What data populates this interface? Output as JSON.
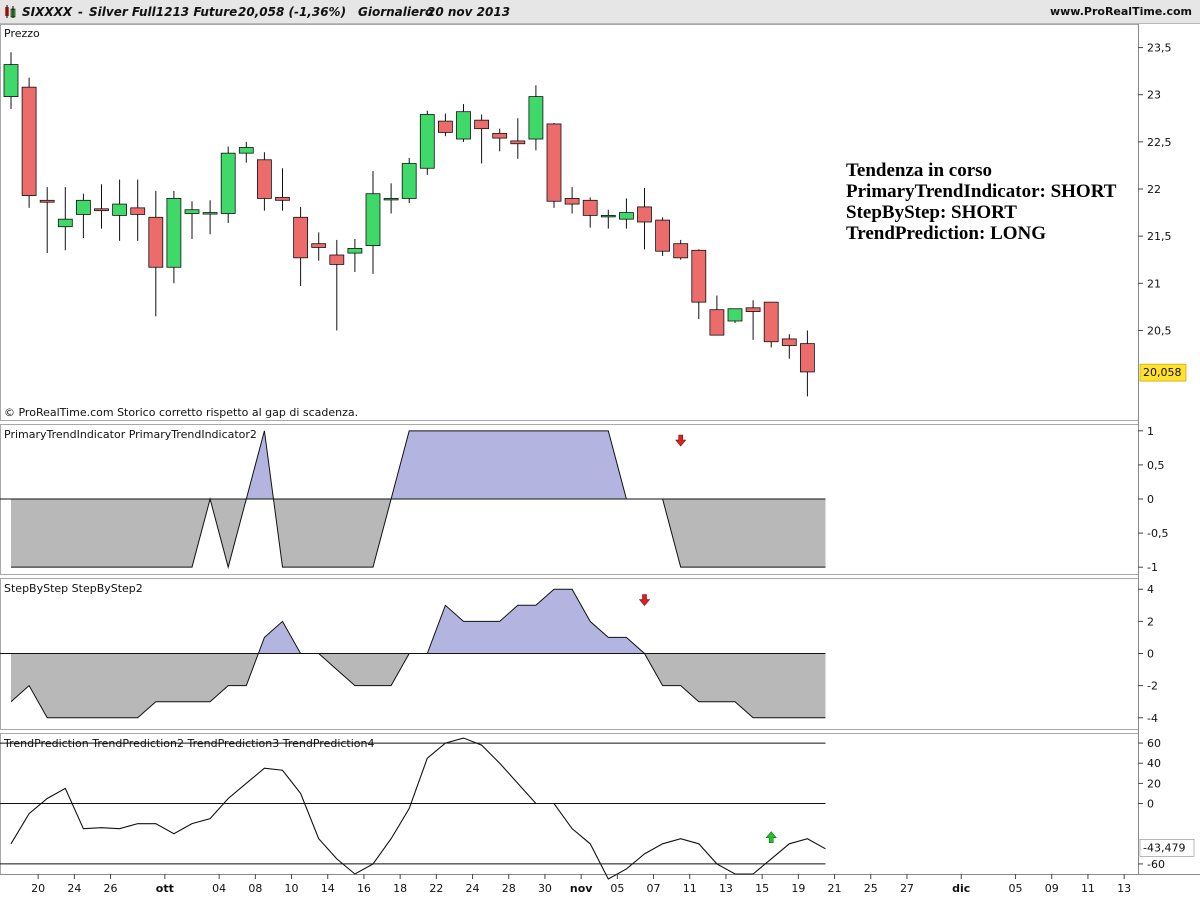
{
  "header": {
    "symbol": "SIXXXX",
    "instrument": "Silver Full1213 Future",
    "quote": "20,058 (-1,36%)",
    "period": "Giornaliero",
    "date": "20 nov 2013",
    "site": "www.ProRealTime.com"
  },
  "trend_box": {
    "title": "Tendenza in corso",
    "line1": "PrimaryTrendIndicator: SHORT",
    "line2": "StepByStep: SHORT",
    "line3": "TrendPrediction: LONG"
  },
  "colors": {
    "bullish": "#3fd96a",
    "bearish": "#ec6b6b",
    "positive_fill": "#b4b4e0",
    "negative_fill": "#b8b8b8",
    "last_price_bg": "#ffe12e",
    "arrow_down": "#e02020",
    "arrow_up": "#22c42a"
  },
  "chart_data": [
    {
      "type": "candlestick",
      "panel_label": "Prezzo",
      "footnote": "© ProRealTime.com  Storico corretto rispetto al gap di scadenza.",
      "ylim": [
        19.55,
        23.75
      ],
      "yticks": [
        "23,5",
        "23",
        "22,5",
        "22",
        "21,5",
        "21",
        "20,5"
      ],
      "ytick_values": [
        23.5,
        23,
        22.5,
        22,
        21.5,
        21,
        20.5
      ],
      "last_price_label": "20,058",
      "last_price": 20.058,
      "candles": [
        {
          "o": 22.98,
          "h": 23.45,
          "l": 22.85,
          "c": 23.32
        },
        {
          "o": 23.08,
          "h": 23.18,
          "l": 21.8,
          "c": 21.93
        },
        {
          "o": 21.88,
          "h": 22.02,
          "l": 21.32,
          "c": 21.86
        },
        {
          "o": 21.6,
          "h": 22.02,
          "l": 21.35,
          "c": 21.68
        },
        {
          "o": 21.73,
          "h": 21.95,
          "l": 21.48,
          "c": 21.88
        },
        {
          "o": 21.79,
          "h": 22.05,
          "l": 21.58,
          "c": 21.77
        },
        {
          "o": 21.72,
          "h": 22.1,
          "l": 21.45,
          "c": 21.84
        },
        {
          "o": 21.8,
          "h": 22.1,
          "l": 21.45,
          "c": 21.73
        },
        {
          "o": 21.7,
          "h": 21.98,
          "l": 20.65,
          "c": 21.17
        },
        {
          "o": 21.17,
          "h": 21.98,
          "l": 21.0,
          "c": 21.9
        },
        {
          "o": 21.74,
          "h": 21.87,
          "l": 21.47,
          "c": 21.78
        },
        {
          "o": 21.74,
          "h": 21.88,
          "l": 21.52,
          "c": 21.75
        },
        {
          "o": 21.74,
          "h": 22.45,
          "l": 21.64,
          "c": 22.38
        },
        {
          "o": 22.38,
          "h": 22.5,
          "l": 22.28,
          "c": 22.44
        },
        {
          "o": 22.31,
          "h": 22.39,
          "l": 21.77,
          "c": 21.9
        },
        {
          "o": 21.91,
          "h": 22.22,
          "l": 21.77,
          "c": 21.88
        },
        {
          "o": 21.7,
          "h": 21.81,
          "l": 20.97,
          "c": 21.27
        },
        {
          "o": 21.42,
          "h": 21.54,
          "l": 21.24,
          "c": 21.38
        },
        {
          "o": 21.3,
          "h": 21.46,
          "l": 20.5,
          "c": 21.2
        },
        {
          "o": 21.32,
          "h": 21.47,
          "l": 21.12,
          "c": 21.37
        },
        {
          "o": 21.4,
          "h": 22.19,
          "l": 21.1,
          "c": 21.95
        },
        {
          "o": 21.9,
          "h": 22.06,
          "l": 21.74,
          "c": 21.9
        },
        {
          "o": 21.9,
          "h": 22.33,
          "l": 21.85,
          "c": 22.27
        },
        {
          "o": 22.22,
          "h": 22.83,
          "l": 22.15,
          "c": 22.79
        },
        {
          "o": 22.72,
          "h": 22.8,
          "l": 22.56,
          "c": 22.6
        },
        {
          "o": 22.53,
          "h": 22.9,
          "l": 22.5,
          "c": 22.82
        },
        {
          "o": 22.73,
          "h": 22.79,
          "l": 22.27,
          "c": 22.64
        },
        {
          "o": 22.59,
          "h": 22.64,
          "l": 22.4,
          "c": 22.54
        },
        {
          "o": 22.51,
          "h": 22.75,
          "l": 22.32,
          "c": 22.48
        },
        {
          "o": 22.53,
          "h": 23.1,
          "l": 22.41,
          "c": 22.98
        },
        {
          "o": 22.69,
          "h": 22.7,
          "l": 21.8,
          "c": 21.87
        },
        {
          "o": 21.9,
          "h": 22.02,
          "l": 21.74,
          "c": 21.84
        },
        {
          "o": 21.88,
          "h": 21.91,
          "l": 21.59,
          "c": 21.72
        },
        {
          "o": 21.71,
          "h": 21.78,
          "l": 21.58,
          "c": 21.72
        },
        {
          "o": 21.68,
          "h": 21.9,
          "l": 21.58,
          "c": 21.75
        },
        {
          "o": 21.81,
          "h": 22.01,
          "l": 21.36,
          "c": 21.65
        },
        {
          "o": 21.67,
          "h": 21.7,
          "l": 21.29,
          "c": 21.34
        },
        {
          "o": 21.42,
          "h": 21.46,
          "l": 21.25,
          "c": 21.27
        },
        {
          "o": 21.35,
          "h": 21.36,
          "l": 20.62,
          "c": 20.8
        },
        {
          "o": 20.72,
          "h": 20.87,
          "l": 20.45,
          "c": 20.45
        },
        {
          "o": 20.6,
          "h": 20.72,
          "l": 20.58,
          "c": 20.73
        },
        {
          "o": 20.74,
          "h": 20.82,
          "l": 20.4,
          "c": 20.7
        },
        {
          "o": 20.8,
          "h": 20.8,
          "l": 20.32,
          "c": 20.38
        },
        {
          "o": 20.41,
          "h": 20.46,
          "l": 20.2,
          "c": 20.34
        },
        {
          "o": 20.36,
          "h": 20.5,
          "l": 19.8,
          "c": 20.06
        }
      ]
    },
    {
      "type": "area",
      "panel_label": "PrimaryTrendIndicator PrimaryTrendIndicator2",
      "ylim": [
        -1.1,
        1.1
      ],
      "yticks": [
        "1",
        "0,5",
        "0",
        "-0,5",
        "-1"
      ],
      "ytick_values": [
        1,
        0.5,
        0,
        -0.5,
        -1
      ],
      "values": [
        -1,
        -1,
        -1,
        -1,
        -1,
        -1,
        -1,
        -1,
        -1,
        -1,
        -1,
        0,
        -1,
        0,
        1,
        -1,
        -1,
        -1,
        -1,
        -1,
        -1,
        0,
        1,
        1,
        1,
        1,
        1,
        1,
        1,
        1,
        1,
        1,
        1,
        1,
        0,
        0,
        0,
        -1,
        -1,
        -1,
        -1,
        -1,
        -1,
        -1,
        -1,
        -1
      ],
      "arrow": {
        "direction": "down",
        "index": 37,
        "value": 0.85
      }
    },
    {
      "type": "area",
      "panel_label": "StepByStep StepByStep2",
      "ylim": [
        -4.7,
        4.7
      ],
      "yticks": [
        "4",
        "2",
        "0",
        "-2",
        "-4"
      ],
      "ytick_values": [
        4,
        2,
        0,
        -2,
        -4
      ],
      "values": [
        -3,
        -2,
        -4,
        -4,
        -4,
        -4,
        -4,
        -4,
        -3,
        -3,
        -3,
        -3,
        -2,
        -2,
        1,
        2,
        0,
        0,
        -1,
        -2,
        -2,
        -2,
        0,
        0,
        3,
        2,
        2,
        2,
        3,
        3,
        4,
        4,
        2,
        1,
        1,
        0,
        -2,
        -2,
        -3,
        -3,
        -3,
        -4,
        -4,
        -4,
        -4,
        -4
      ],
      "arrow": {
        "direction": "down",
        "index": 35,
        "value": 3.3
      }
    },
    {
      "type": "line",
      "panel_label": "TrendPrediction TrendPrediction2 TrendPrediction3 TrendPrediction4",
      "ylim": [
        -70,
        70
      ],
      "yticks": [
        "60",
        "40",
        "20",
        "0",
        "-60"
      ],
      "ytick_values": [
        60,
        40,
        20,
        0,
        -60
      ],
      "last_value_label": "-43,479",
      "last_value": -43.479,
      "reference_lines": [
        60,
        0,
        -60
      ],
      "values": [
        -40,
        -10,
        5,
        15,
        -25,
        -24,
        -25,
        -20,
        -20,
        -30,
        -20,
        -15,
        5,
        20,
        35,
        33,
        10,
        -35,
        -55,
        -70,
        -60,
        -35,
        -5,
        45,
        60,
        65,
        58,
        40,
        20,
        0,
        0,
        -25,
        -40,
        -75,
        -65,
        -50,
        -40,
        -35,
        -40,
        -60,
        -70,
        -70,
        -55,
        -40,
        -35,
        -45
      ],
      "arrow": {
        "direction": "up",
        "index": 42,
        "value": -33
      }
    }
  ],
  "x_axis": {
    "labels": [
      {
        "text": "20",
        "pos": 1.5,
        "bold": false
      },
      {
        "text": "24",
        "pos": 3.5,
        "bold": false
      },
      {
        "text": "26",
        "pos": 5.5,
        "bold": false
      },
      {
        "text": "ott",
        "pos": 8.5,
        "bold": true
      },
      {
        "text": "04",
        "pos": 11.5,
        "bold": false
      },
      {
        "text": "08",
        "pos": 13.5,
        "bold": false
      },
      {
        "text": "10",
        "pos": 15.5,
        "bold": false
      },
      {
        "text": "14",
        "pos": 17.5,
        "bold": false
      },
      {
        "text": "16",
        "pos": 19.5,
        "bold": false
      },
      {
        "text": "18",
        "pos": 21.5,
        "bold": false
      },
      {
        "text": "22",
        "pos": 23.5,
        "bold": false
      },
      {
        "text": "24",
        "pos": 25.5,
        "bold": false
      },
      {
        "text": "28",
        "pos": 27.5,
        "bold": false
      },
      {
        "text": "30",
        "pos": 29.5,
        "bold": false
      },
      {
        "text": "nov",
        "pos": 31.5,
        "bold": true
      },
      {
        "text": "05",
        "pos": 33.5,
        "bold": false
      },
      {
        "text": "07",
        "pos": 35.5,
        "bold": false
      },
      {
        "text": "11",
        "pos": 37.5,
        "bold": false
      },
      {
        "text": "13",
        "pos": 39.5,
        "bold": false
      },
      {
        "text": "15",
        "pos": 41.5,
        "bold": false
      },
      {
        "text": "19",
        "pos": 43.5,
        "bold": false
      },
      {
        "text": "21",
        "pos": 45.5,
        "bold": false
      },
      {
        "text": "25",
        "pos": 47.5,
        "bold": false
      },
      {
        "text": "27",
        "pos": 49.5,
        "bold": false
      },
      {
        "text": "dic",
        "pos": 52.5,
        "bold": true
      },
      {
        "text": "05",
        "pos": 55.5,
        "bold": false
      },
      {
        "text": "09",
        "pos": 57.5,
        "bold": false
      },
      {
        "text": "11",
        "pos": 59.5,
        "bold": false
      },
      {
        "text": "13",
        "pos": 61.5,
        "bold": false
      }
    ]
  }
}
